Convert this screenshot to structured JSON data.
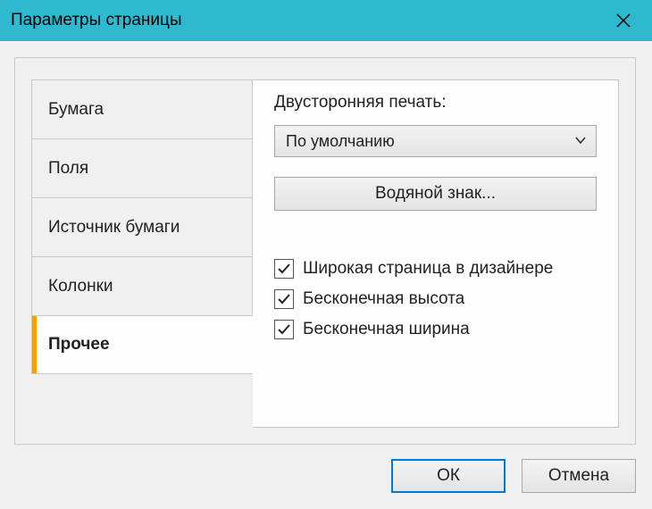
{
  "window": {
    "title": "Параметры страницы"
  },
  "tabs": {
    "items": [
      {
        "label": "Бумага"
      },
      {
        "label": "Поля"
      },
      {
        "label": "Источник бумаги"
      },
      {
        "label": "Колонки"
      },
      {
        "label": "Прочее"
      }
    ],
    "active_index": 4
  },
  "content": {
    "duplex_label": "Двусторонняя печать:",
    "duplex_selected": "По умолчанию",
    "watermark_button": "Водяной знак...",
    "checks": [
      {
        "label": "Широкая страница в дизайнере",
        "checked": true
      },
      {
        "label": "Бесконечная высота",
        "checked": true
      },
      {
        "label": "Бесконечная ширина",
        "checked": true
      }
    ]
  },
  "buttons": {
    "ok": "ОК",
    "cancel": "Отмена"
  }
}
